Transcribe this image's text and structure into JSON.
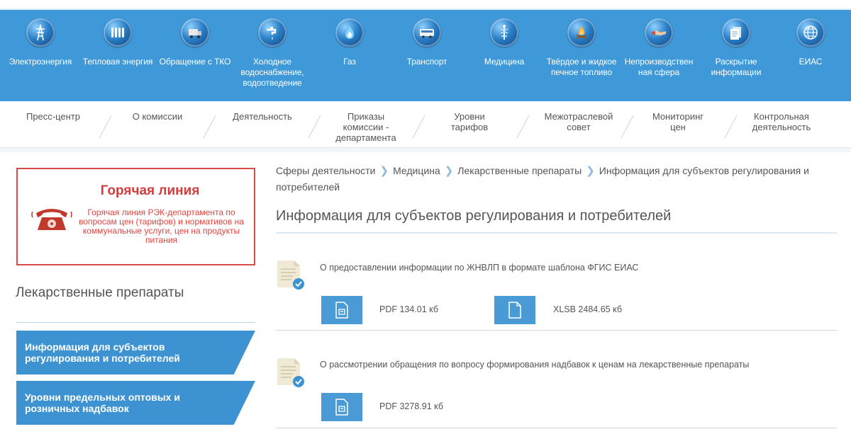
{
  "sectors": [
    {
      "label": "Электроэнергия",
      "icon": "power-tower-icon"
    },
    {
      "label": "Тепловая энергия",
      "icon": "radiator-icon"
    },
    {
      "label": "Обращение с ТКО",
      "icon": "garbage-truck-icon"
    },
    {
      "label": "Холодное\nводоснабжение,\nводоотведение",
      "icon": "water-tap-icon"
    },
    {
      "label": "Газ",
      "icon": "gas-flame-icon"
    },
    {
      "label": "Транспорт",
      "icon": "bus-icon"
    },
    {
      "label": "Медицина",
      "icon": "medical-caduceus-icon"
    },
    {
      "label": "Твёрдое и жидкое\nпечное топливо",
      "icon": "campfire-icon"
    },
    {
      "label": "Непроизводствен\nная сфера",
      "icon": "handshake-icon"
    },
    {
      "label": "Раскрытие\nинформации",
      "icon": "documents-icon"
    },
    {
      "label": "ЕИАС",
      "icon": "globe-icon"
    }
  ],
  "subnav": [
    "Пресс-центр",
    "О комиссии",
    "Деятельность",
    "Приказы\nкомиссии -\nдепартамента",
    "Уровни\nтарифов",
    "Межотраслевой\nсовет",
    "Мониторинг\nцен",
    "Контрольная\nдеятельность"
  ],
  "hotline": {
    "title": "Горячая линия",
    "description": "Горячая линия РЭК-департамента по вопросам цен (тарифов) и нормативов на коммунальные услуги, цен на продукты питания",
    "color": "#d84b4b"
  },
  "sidebar": {
    "title": "Лекарственные препараты",
    "items": [
      "Информация для субъектов регулирования и потребителей",
      "Уровни предельных оптовых и розничных надбавок"
    ]
  },
  "breadcrumb": [
    "Сферы деятельности",
    "Медицина",
    "Лекарственные препараты",
    "Информация для субъектов регулирования и потребителей"
  ],
  "page_title": "Информация для субъектов регулирования и потребителей",
  "documents": [
    {
      "title": "О предоставлении информации по ЖНВЛП в формате шаблона ФГИС ЕИАС",
      "files": [
        {
          "label": "PDF 134.01 кб",
          "icon": "pdf-file-icon"
        },
        {
          "label": "XLSB 2484.65 кб",
          "icon": "blank-file-icon"
        }
      ]
    },
    {
      "title": "О рассмотрении обращения по вопросу формирования надбавок к ценам на лекарственные препараты",
      "files": [
        {
          "label": "PDF 3278.91 кб",
          "icon": "pdf-file-icon"
        }
      ]
    }
  ],
  "colors": {
    "topbar": "#3f98d7",
    "accent": "#3d93d1",
    "hotline_red": "#d84b4b"
  }
}
